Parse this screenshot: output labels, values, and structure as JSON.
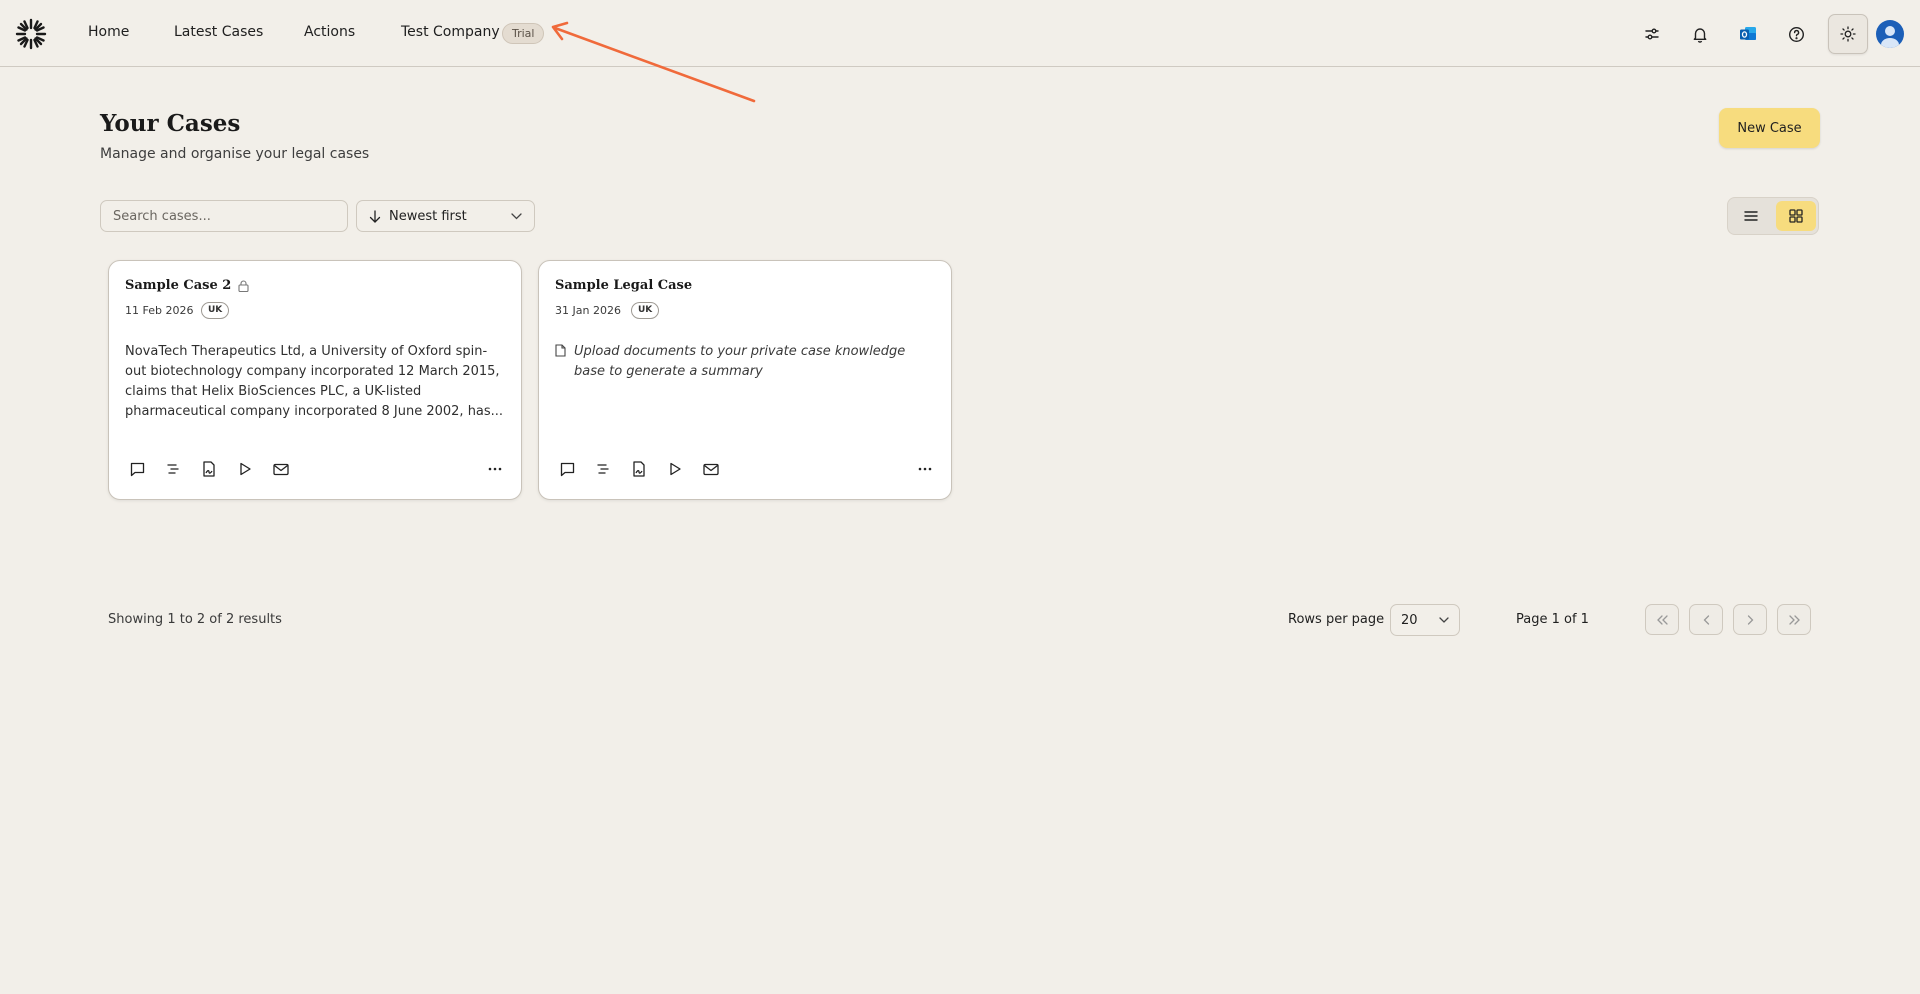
{
  "nav": {
    "items": [
      {
        "label": "Home"
      },
      {
        "label": "Latest Cases"
      },
      {
        "label": "Actions"
      },
      {
        "label": "Test Company"
      }
    ],
    "company_badge": "Trial",
    "annotation_arrow_color": "#f06a3b"
  },
  "header_icons": [
    "sliders-icon",
    "bell-icon",
    "outlook-icon",
    "help-icon",
    "sun-icon",
    "user-avatar"
  ],
  "page": {
    "title": "Your Cases",
    "subtitle": "Manage and organise your legal cases",
    "new_case_label": "New Case"
  },
  "filters": {
    "search_placeholder": "Search cases...",
    "sort_label": "Newest first"
  },
  "view_toggle": {
    "options": [
      "list",
      "grid"
    ],
    "active": "grid"
  },
  "cases": [
    {
      "title": "Sample Case 2",
      "locked": true,
      "date": "11 Feb 2026",
      "jurisdiction": "UK",
      "description": "NovaTech Therapeutics Ltd, a University of Oxford spin-out biotechnology company incorporated 12 March 2015, claims that Helix BioSciences PLC, a UK-listed pharmaceutical company incorporated 8 June 2002, has..."
    },
    {
      "title": "Sample Legal Case",
      "locked": false,
      "date": "31 Jan 2026",
      "jurisdiction": "UK",
      "empty_message": "Upload documents to your private case knowledge base to generate a summary"
    }
  ],
  "card_actions": [
    "chat-icon",
    "list-icon",
    "document-sign-icon",
    "play-icon",
    "mail-icon"
  ],
  "pagination": {
    "showing": "Showing 1 to 2 of 2 results",
    "rows_label": "Rows per page",
    "rows_value": "20",
    "page_info": "Page 1 of 1"
  },
  "colors": {
    "background": "#f2efe9",
    "accent": "#f7dc7e",
    "avatar": "#1c5fb8"
  }
}
